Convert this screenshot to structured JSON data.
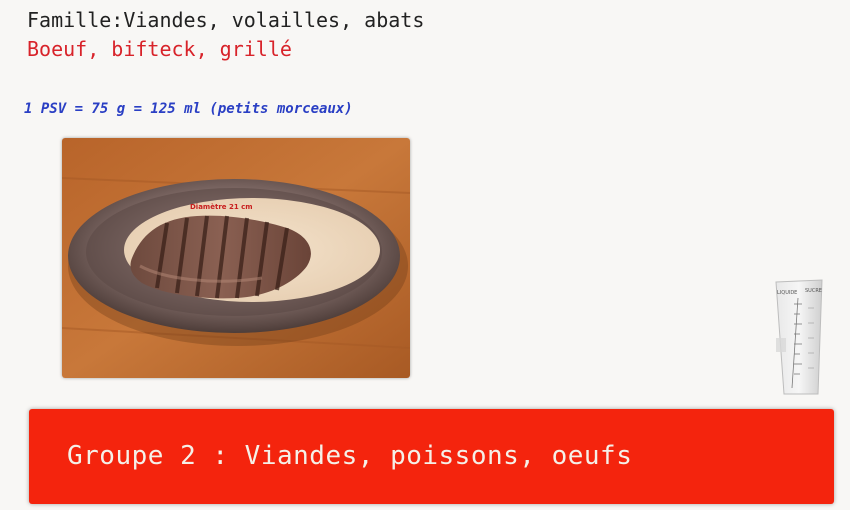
{
  "header": {
    "family_label": "Famille:Viandes, volailles, abats",
    "food_name": "Boeuf, bifteck, grillé"
  },
  "portion": {
    "text": "1 PSV = 75 g = 125 ml (petits morceaux)"
  },
  "photo": {
    "plate_label": "Diamètre 21 cm"
  },
  "measuring_cup": {
    "label_left": "LIQUIDE",
    "label_right": "SUCRE"
  },
  "banner": {
    "label": "Groupe 2 : Viandes, poissons, oeufs",
    "color": "#f4240d"
  }
}
